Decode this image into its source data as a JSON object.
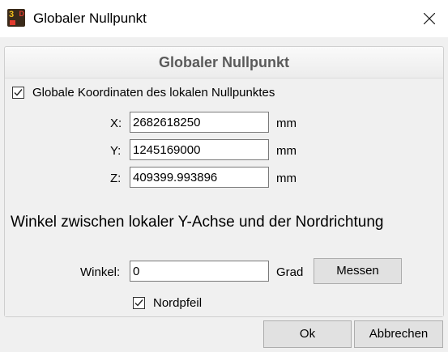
{
  "window": {
    "title": "Globaler Nullpunkt"
  },
  "panel": {
    "header": "Globaler Nullpunkt",
    "global_coords_checkbox": {
      "label": "Globale Koordinaten des lokalen Nullpunktes",
      "checked": true
    },
    "coords": [
      {
        "label": "X:",
        "value": "2682618250",
        "unit": "mm"
      },
      {
        "label": "Y:",
        "value": "1245169000",
        "unit": "mm"
      },
      {
        "label": "Z:",
        "value": "409399.993896",
        "unit": "mm"
      }
    ],
    "angle_heading": "Winkel zwischen lokaler Y-Achse und der Nordrichtung",
    "angle": {
      "label": "Winkel:",
      "value": "0",
      "unit": "Grad",
      "measure_button": "Messen"
    },
    "north_arrow_checkbox": {
      "label": "Nordpfeil",
      "checked": true
    }
  },
  "footer": {
    "ok_button": "Ok",
    "cancel_button": "Abbrechen"
  }
}
